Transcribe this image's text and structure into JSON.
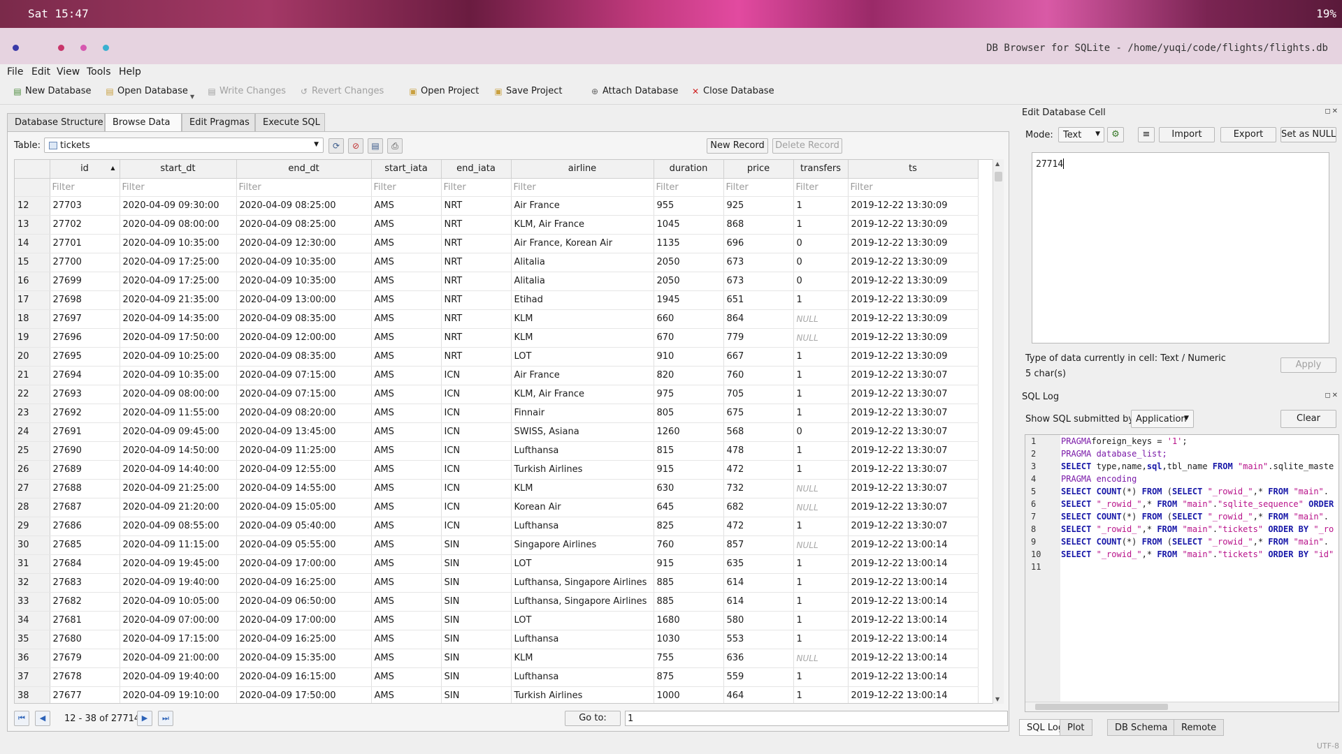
{
  "desktop": {
    "clock": "Sat 15:47",
    "battery": "19%"
  },
  "window": {
    "title": "DB Browser for SQLite - /home/yuqi/code/flights/flights.db"
  },
  "menu": [
    "File",
    "Edit",
    "View",
    "Tools",
    "Help"
  ],
  "toolbar": {
    "new_database": "New Database",
    "open_database": "Open Database",
    "write_changes": "Write Changes",
    "revert_changes": "Revert Changes",
    "open_project": "Open Project",
    "save_project": "Save Project",
    "attach_database": "Attach Database",
    "close_database": "Close Database"
  },
  "tabs": [
    "Database Structure",
    "Browse Data",
    "Edit Pragmas",
    "Execute SQL"
  ],
  "browse": {
    "table_label": "Table:",
    "table_name": "tickets",
    "new_record": "New Record",
    "delete_record": "Delete Record",
    "filter_placeholder": "Filter",
    "columns": [
      "id",
      "start_dt",
      "end_dt",
      "start_iata",
      "end_iata",
      "airline",
      "duration",
      "price",
      "transfers",
      "ts"
    ],
    "rows": [
      [
        "12",
        "27703",
        "2020-04-09 09:30:00",
        "2020-04-09 08:25:00",
        "AMS",
        "NRT",
        "Air France",
        "955",
        "925",
        "1",
        "2019-12-22 13:30:09"
      ],
      [
        "13",
        "27702",
        "2020-04-09 08:00:00",
        "2020-04-09 08:25:00",
        "AMS",
        "NRT",
        "KLM, Air France",
        "1045",
        "868",
        "1",
        "2019-12-22 13:30:09"
      ],
      [
        "14",
        "27701",
        "2020-04-09 10:35:00",
        "2020-04-09 12:30:00",
        "AMS",
        "NRT",
        "Air France, Korean Air",
        "1135",
        "696",
        "0",
        "2019-12-22 13:30:09"
      ],
      [
        "15",
        "27700",
        "2020-04-09 17:25:00",
        "2020-04-09 10:35:00",
        "AMS",
        "NRT",
        "Alitalia",
        "2050",
        "673",
        "0",
        "2019-12-22 13:30:09"
      ],
      [
        "16",
        "27699",
        "2020-04-09 17:25:00",
        "2020-04-09 10:35:00",
        "AMS",
        "NRT",
        "Alitalia",
        "2050",
        "673",
        "0",
        "2019-12-22 13:30:09"
      ],
      [
        "17",
        "27698",
        "2020-04-09 21:35:00",
        "2020-04-09 13:00:00",
        "AMS",
        "NRT",
        "Etihad",
        "1945",
        "651",
        "1",
        "2019-12-22 13:30:09"
      ],
      [
        "18",
        "27697",
        "2020-04-09 14:35:00",
        "2020-04-09 08:35:00",
        "AMS",
        "NRT",
        "KLM",
        "660",
        "864",
        "NULL",
        "2019-12-22 13:30:09"
      ],
      [
        "19",
        "27696",
        "2020-04-09 17:50:00",
        "2020-04-09 12:00:00",
        "AMS",
        "NRT",
        "KLM",
        "670",
        "779",
        "NULL",
        "2019-12-22 13:30:09"
      ],
      [
        "20",
        "27695",
        "2020-04-09 10:25:00",
        "2020-04-09 08:35:00",
        "AMS",
        "NRT",
        "LOT",
        "910",
        "667",
        "1",
        "2019-12-22 13:30:09"
      ],
      [
        "21",
        "27694",
        "2020-04-09 10:35:00",
        "2020-04-09 07:15:00",
        "AMS",
        "ICN",
        "Air France",
        "820",
        "760",
        "1",
        "2019-12-22 13:30:07"
      ],
      [
        "22",
        "27693",
        "2020-04-09 08:00:00",
        "2020-04-09 07:15:00",
        "AMS",
        "ICN",
        "KLM, Air France",
        "975",
        "705",
        "1",
        "2019-12-22 13:30:07"
      ],
      [
        "23",
        "27692",
        "2020-04-09 11:55:00",
        "2020-04-09 08:20:00",
        "AMS",
        "ICN",
        "Finnair",
        "805",
        "675",
        "1",
        "2019-12-22 13:30:07"
      ],
      [
        "24",
        "27691",
        "2020-04-09 09:45:00",
        "2020-04-09 13:45:00",
        "AMS",
        "ICN",
        "SWISS, Asiana",
        "1260",
        "568",
        "0",
        "2019-12-22 13:30:07"
      ],
      [
        "25",
        "27690",
        "2020-04-09 14:50:00",
        "2020-04-09 11:25:00",
        "AMS",
        "ICN",
        "Lufthansa",
        "815",
        "478",
        "1",
        "2019-12-22 13:30:07"
      ],
      [
        "26",
        "27689",
        "2020-04-09 14:40:00",
        "2020-04-09 12:55:00",
        "AMS",
        "ICN",
        "Turkish Airlines",
        "915",
        "472",
        "1",
        "2019-12-22 13:30:07"
      ],
      [
        "27",
        "27688",
        "2020-04-09 21:25:00",
        "2020-04-09 14:55:00",
        "AMS",
        "ICN",
        "KLM",
        "630",
        "732",
        "NULL",
        "2019-12-22 13:30:07"
      ],
      [
        "28",
        "27687",
        "2020-04-09 21:20:00",
        "2020-04-09 15:05:00",
        "AMS",
        "ICN",
        "Korean Air",
        "645",
        "682",
        "NULL",
        "2019-12-22 13:30:07"
      ],
      [
        "29",
        "27686",
        "2020-04-09 08:55:00",
        "2020-04-09 05:40:00",
        "AMS",
        "ICN",
        "Lufthansa",
        "825",
        "472",
        "1",
        "2019-12-22 13:30:07"
      ],
      [
        "30",
        "27685",
        "2020-04-09 11:15:00",
        "2020-04-09 05:55:00",
        "AMS",
        "SIN",
        "Singapore Airlines",
        "760",
        "857",
        "NULL",
        "2019-12-22 13:00:14"
      ],
      [
        "31",
        "27684",
        "2020-04-09 19:45:00",
        "2020-04-09 17:00:00",
        "AMS",
        "SIN",
        "LOT",
        "915",
        "635",
        "1",
        "2019-12-22 13:00:14"
      ],
      [
        "32",
        "27683",
        "2020-04-09 19:40:00",
        "2020-04-09 16:25:00",
        "AMS",
        "SIN",
        "Lufthansa, Singapore Airlines",
        "885",
        "614",
        "1",
        "2019-12-22 13:00:14"
      ],
      [
        "33",
        "27682",
        "2020-04-09 10:05:00",
        "2020-04-09 06:50:00",
        "AMS",
        "SIN",
        "Lufthansa, Singapore Airlines",
        "885",
        "614",
        "1",
        "2019-12-22 13:00:14"
      ],
      [
        "34",
        "27681",
        "2020-04-09 07:00:00",
        "2020-04-09 17:00:00",
        "AMS",
        "SIN",
        "LOT",
        "1680",
        "580",
        "1",
        "2019-12-22 13:00:14"
      ],
      [
        "35",
        "27680",
        "2020-04-09 17:15:00",
        "2020-04-09 16:25:00",
        "AMS",
        "SIN",
        "Lufthansa",
        "1030",
        "553",
        "1",
        "2019-12-22 13:00:14"
      ],
      [
        "36",
        "27679",
        "2020-04-09 21:00:00",
        "2020-04-09 15:35:00",
        "AMS",
        "SIN",
        "KLM",
        "755",
        "636",
        "NULL",
        "2019-12-22 13:00:14"
      ],
      [
        "37",
        "27678",
        "2020-04-09 19:40:00",
        "2020-04-09 16:15:00",
        "AMS",
        "SIN",
        "Lufthansa",
        "875",
        "559",
        "1",
        "2019-12-22 13:00:14"
      ],
      [
        "38",
        "27677",
        "2020-04-09 19:10:00",
        "2020-04-09 17:50:00",
        "AMS",
        "SIN",
        "Turkish Airlines",
        "1000",
        "464",
        "1",
        "2019-12-22 13:00:14"
      ]
    ],
    "pager_text": "12 - 38 of 27714",
    "goto_label": "Go to:",
    "goto_value": "1"
  },
  "edit_cell": {
    "title": "Edit Database Cell",
    "mode_label": "Mode:",
    "mode_value": "Text",
    "import": "Import",
    "export": "Export",
    "set_null": "Set as NULL",
    "value": "27714",
    "type_info": "Type of data currently in cell: Text / Numeric",
    "size_info": "5 char(s)",
    "apply": "Apply"
  },
  "sql_log": {
    "title": "SQL Log",
    "show_label": "Show SQL submitted by",
    "source": "Application",
    "clear": "Clear",
    "lines": [
      {
        "n": "1",
        "parts": [
          [
            "pragma",
            "PRAGMA"
          ],
          [
            "",
            "foreign_keys = "
          ],
          [
            "str",
            "'1'"
          ],
          [
            "",
            ";"
          ]
        ]
      },
      {
        "n": "2",
        "parts": [
          [
            "pragma",
            "PRAGMA"
          ],
          [
            "",
            ""
          ],
          [
            "pragma",
            " database_list;"
          ]
        ]
      },
      {
        "n": "3",
        "parts": [
          [
            "kw",
            "SELECT"
          ],
          [
            "",
            " type,name,"
          ],
          [
            "kw",
            "sql"
          ],
          [
            "",
            ",tbl_name "
          ],
          [
            "kw",
            "FROM"
          ],
          [
            "",
            ""
          ],
          [
            "str",
            " \"main\""
          ],
          [
            "",
            ".sqlite_maste"
          ]
        ]
      },
      {
        "n": "4",
        "parts": [
          [
            "pragma",
            "PRAGMA"
          ],
          [
            "pragma",
            " encoding"
          ]
        ]
      },
      {
        "n": "5",
        "parts": [
          [
            "kw",
            "SELECT"
          ],
          [
            "",
            " "
          ],
          [
            "kw",
            "COUNT"
          ],
          [
            "",
            "(*) "
          ],
          [
            "kw",
            "FROM"
          ],
          [
            "",
            " ("
          ],
          [
            "kw",
            "SELECT"
          ],
          [
            "",
            " "
          ],
          [
            "str",
            "\"_rowid_\""
          ],
          [
            "",
            ",* "
          ],
          [
            "kw",
            "FROM"
          ],
          [
            "",
            " "
          ],
          [
            "str",
            "\"main\""
          ],
          [
            "",
            "."
          ]
        ]
      },
      {
        "n": "6",
        "parts": [
          [
            "kw",
            "SELECT"
          ],
          [
            "",
            " "
          ],
          [
            "str",
            "\"_rowid_\""
          ],
          [
            "",
            ",* "
          ],
          [
            "kw",
            "FROM"
          ],
          [
            "",
            " "
          ],
          [
            "str",
            "\"main\""
          ],
          [
            "",
            "."
          ],
          [
            "str",
            "\"sqlite_sequence\""
          ],
          [
            "",
            " "
          ],
          [
            "kw",
            "ORDER"
          ]
        ]
      },
      {
        "n": "7",
        "parts": [
          [
            "kw",
            "SELECT"
          ],
          [
            "",
            " "
          ],
          [
            "kw",
            "COUNT"
          ],
          [
            "",
            "(*) "
          ],
          [
            "kw",
            "FROM"
          ],
          [
            "",
            " ("
          ],
          [
            "kw",
            "SELECT"
          ],
          [
            "",
            " "
          ],
          [
            "str",
            "\"_rowid_\""
          ],
          [
            "",
            ",* "
          ],
          [
            "kw",
            "FROM"
          ],
          [
            "",
            " "
          ],
          [
            "str",
            "\"main\""
          ],
          [
            "",
            "."
          ]
        ]
      },
      {
        "n": "8",
        "parts": [
          [
            "kw",
            "SELECT"
          ],
          [
            "",
            " "
          ],
          [
            "str",
            "\"_rowid_\""
          ],
          [
            "",
            ",* "
          ],
          [
            "kw",
            "FROM"
          ],
          [
            "",
            " "
          ],
          [
            "str",
            "\"main\""
          ],
          [
            "",
            "."
          ],
          [
            "str",
            "\"tickets\""
          ],
          [
            "",
            " "
          ],
          [
            "kw",
            "ORDER BY"
          ],
          [
            "",
            " "
          ],
          [
            "str",
            "\"_ro"
          ]
        ]
      },
      {
        "n": "9",
        "parts": [
          [
            "kw",
            "SELECT"
          ],
          [
            "",
            " "
          ],
          [
            "kw",
            "COUNT"
          ],
          [
            "",
            "(*) "
          ],
          [
            "kw",
            "FROM"
          ],
          [
            "",
            " ("
          ],
          [
            "kw",
            "SELECT"
          ],
          [
            "",
            " "
          ],
          [
            "str",
            "\"_rowid_\""
          ],
          [
            "",
            ",* "
          ],
          [
            "kw",
            "FROM"
          ],
          [
            "",
            " "
          ],
          [
            "str",
            "\"main\""
          ],
          [
            "",
            "."
          ]
        ]
      },
      {
        "n": "10",
        "parts": [
          [
            "kw",
            "SELECT"
          ],
          [
            "",
            " "
          ],
          [
            "str",
            "\"_rowid_\""
          ],
          [
            "",
            ",* "
          ],
          [
            "kw",
            "FROM"
          ],
          [
            "",
            " "
          ],
          [
            "str",
            "\"main\""
          ],
          [
            "",
            "."
          ],
          [
            "str",
            "\"tickets\""
          ],
          [
            "",
            " "
          ],
          [
            "kw",
            "ORDER BY"
          ],
          [
            "",
            " "
          ],
          [
            "str",
            "\"id\""
          ]
        ]
      },
      {
        "n": "11",
        "parts": []
      }
    ]
  },
  "bottom_tabs": [
    "SQL Log",
    "Plot",
    "DB Schema",
    "Remote"
  ],
  "status": {
    "encoding": "UTF-8"
  }
}
